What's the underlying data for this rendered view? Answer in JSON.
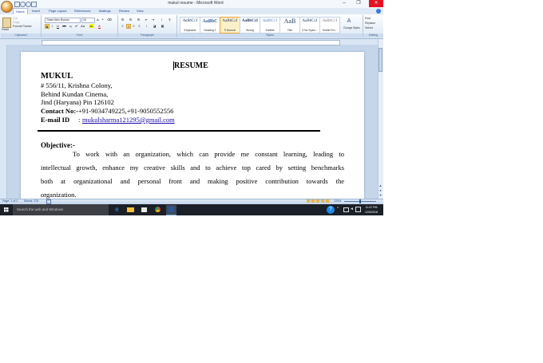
{
  "window": {
    "title": "mukul resume - Microsoft Word",
    "minimize": "–",
    "maximize": "❐",
    "close": "✕"
  },
  "tabs": [
    "Home",
    "Insert",
    "Page Layout",
    "References",
    "Mailings",
    "Review",
    "View"
  ],
  "ribbon": {
    "clipboard": {
      "paste": "Paste",
      "cut": "Cut",
      "copy": "Copy",
      "format_painter": "Format Painter",
      "label": "Clipboard"
    },
    "font": {
      "name": "Times New Roman",
      "size": "16",
      "label": "Font"
    },
    "paragraph": {
      "label": "Paragraph"
    },
    "styles": {
      "label": "Styles",
      "items": [
        {
          "sample": "AaBbCcI",
          "name": "Emphasis"
        },
        {
          "sample": "AaBbC",
          "name": "Heading 1"
        },
        {
          "sample": "AaBbCcI",
          "name": "¶ Normal"
        },
        {
          "sample": "AaBbCcI",
          "name": "Strong"
        },
        {
          "sample": "AaBbCcI",
          "name": "Subtitle"
        },
        {
          "sample": "AaB",
          "name": "Title"
        },
        {
          "sample": "AaBbCcI",
          "name": "¶ No Spaci..."
        },
        {
          "sample": "AaBbCcI",
          "name": "Subtle Em..."
        }
      ],
      "change_styles": "Change Styles"
    },
    "editing": {
      "find": "Find",
      "replace": "Replace",
      "select": "Select",
      "label": "Editing"
    }
  },
  "document": {
    "heading": "RESUME",
    "name": "MUKUL",
    "address": [
      "# 556/11, Krishna Colony,",
      "Behind Kundan Cinema,",
      "Jind (Haryana) Pin 126102"
    ],
    "contact_label": "Contact No:-",
    "contact_value": "+91-9034749225,+91-9050552556",
    "email_label": "E-mail ID",
    "email_sep": ":",
    "email_value": "mukulsharma121295@gmail.com",
    "objective_label": "Objective:-",
    "objective_lines": [
      "To work with an organization, which can provide me constant learning, leading to",
      "intellectual growth, enhance my creative skills and to achieve top cared by setting benchmarks",
      "both at organizational and personal front and making positive contribution towards the",
      "organization."
    ]
  },
  "status": {
    "page": "Page: 1 of 2",
    "words": "Words: 374",
    "zoom": "120%"
  },
  "taskbar": {
    "search_placeholder": "Search the web and Windows",
    "time": "11:47 PM",
    "date": "12/5/2016"
  }
}
